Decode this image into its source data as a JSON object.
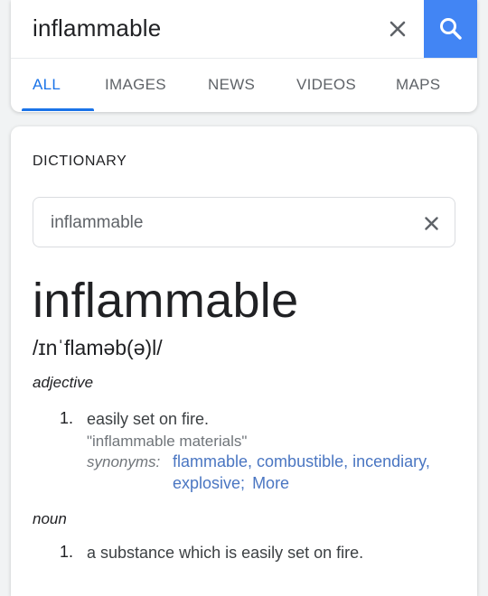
{
  "search": {
    "query": "inflammable",
    "clear_icon": "close-icon",
    "search_icon": "search-icon",
    "accent": "#4285f4"
  },
  "tabs": [
    {
      "label": "ALL",
      "active": true
    },
    {
      "label": "IMAGES",
      "active": false
    },
    {
      "label": "NEWS",
      "active": false
    },
    {
      "label": "VIDEOS",
      "active": false
    },
    {
      "label": "MAPS",
      "active": false
    }
  ],
  "dictionary": {
    "heading": "DICTIONARY",
    "input_value": "inflammable",
    "headword": "inflammable",
    "phonetic": "/ɪnˈflaməb(ə)l/",
    "entries": [
      {
        "pos": "adjective",
        "senses": [
          {
            "number": "1.",
            "definition": "easily set on fire.",
            "example": "\"inflammable materials\"",
            "synonyms_label": "synonyms:",
            "synonyms": [
              "flammable",
              "combustible",
              "incendiary",
              "explosive"
            ],
            "more_label": "More"
          }
        ]
      },
      {
        "pos": "noun",
        "senses": [
          {
            "number": "1.",
            "definition": "a substance which is easily set on fire."
          }
        ]
      }
    ],
    "link_color": "#4a76c2"
  }
}
